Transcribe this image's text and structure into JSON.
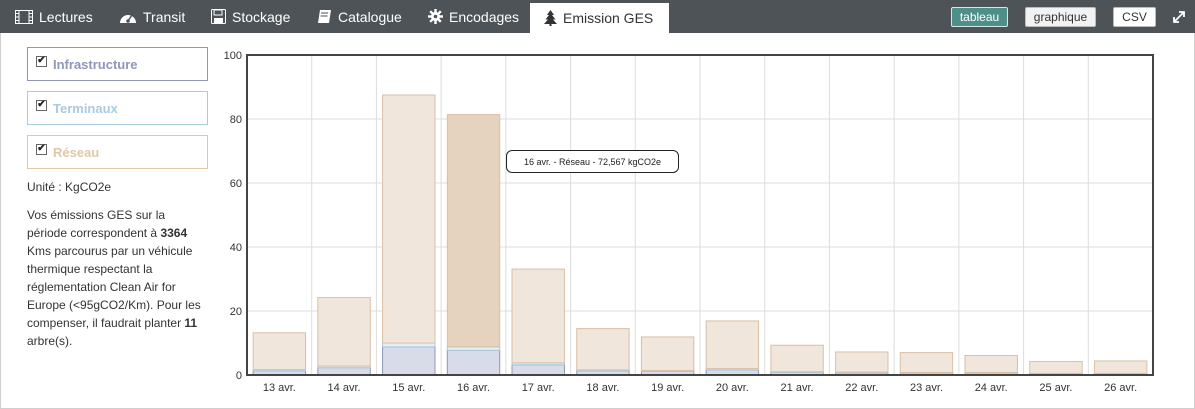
{
  "tabs": [
    {
      "label": "Lectures",
      "icon": "film-icon"
    },
    {
      "label": "Transit",
      "icon": "dashboard-icon"
    },
    {
      "label": "Stockage",
      "icon": "floppy-disk-icon"
    },
    {
      "label": "Catalogue",
      "icon": "book-icon"
    },
    {
      "label": "Encodages",
      "icon": "gear-icon"
    },
    {
      "label": "Emission GES",
      "icon": "tree-icon"
    }
  ],
  "toolbar": {
    "tableau": "tableau",
    "graphique": "graphique",
    "csv": "CSV",
    "expand_icon": "expand-icon"
  },
  "legend": [
    {
      "label": "Infrastructure",
      "color": "#9aa3c2",
      "checked": true
    },
    {
      "label": "Terminaux",
      "color": "#a9cbe0",
      "checked": true
    },
    {
      "label": "Réseau",
      "color": "#e0c8a6",
      "checked": true
    }
  ],
  "unit_text": "Unité : KgCO2e",
  "description": {
    "p1": "Vos émissions GES sur la période correspondent à ",
    "kms": "3364",
    "p2": " Kms parcourus par un véhicule thermique respectant la réglementation Clean Air for Europe (<95gCO2/Km). Pour les compenser, il faudrait planter ",
    "trees": "11",
    "p3": " arbre(s)."
  },
  "tooltip": "16 avr. - Réseau - 72,567 kgCO2e",
  "colors": {
    "infrastructure_fill": "#d8dbe8",
    "infrastructure_stroke": "#8f97b8",
    "terminaux_fill": "#e4eef5",
    "terminaux_stroke": "#a9cbe0",
    "reseau_fill": "#f1e6dc",
    "reseau_stroke": "#d9bfa6",
    "reseau_hover_fill": "#e6d3bf"
  },
  "chart_data": {
    "type": "bar",
    "stacked": true,
    "categories": [
      "13 avr.",
      "14 avr.",
      "15 avr.",
      "16 avr.",
      "17 avr.",
      "18 avr.",
      "19 avr.",
      "20 avr.",
      "21 avr.",
      "22 avr.",
      "23 avr.",
      "24 avr.",
      "25 avr.",
      "26 avr."
    ],
    "series": [
      {
        "name": "Infrastructure",
        "values": [
          1.3,
          2.3,
          8.8,
          7.7,
          3.2,
          1.3,
          1.1,
          1.6,
          0.8,
          0.7,
          0.6,
          0.6,
          0.4,
          0.4
        ]
      },
      {
        "name": "Terminaux",
        "values": [
          0.4,
          0.5,
          1.2,
          1.1,
          0.6,
          0.3,
          0.3,
          0.4,
          0.2,
          0.2,
          0.2,
          0.2,
          0.1,
          0.1
        ]
      },
      {
        "name": "Réseau",
        "values": [
          11.5,
          21.4,
          77.5,
          72.567,
          29.3,
          12.9,
          10.5,
          14.9,
          8.3,
          6.3,
          6.2,
          5.3,
          3.7,
          3.9
        ]
      }
    ],
    "highlight_index": 3,
    "ylim": [
      0,
      100
    ],
    "yticks": [
      0,
      20,
      40,
      60,
      80,
      100
    ],
    "grid": true,
    "legend": "left"
  }
}
